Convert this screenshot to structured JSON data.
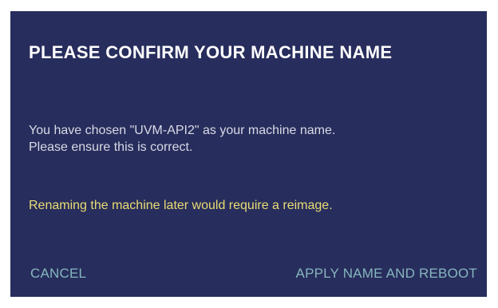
{
  "dialog": {
    "title": "PLEASE CONFIRM YOUR MACHINE NAME",
    "message_line1": "You have chosen \"UVM-API2\" as your machine name.",
    "message_line2": "Please ensure this is correct.",
    "warning": "Renaming the machine later would require a reimage.",
    "cancel_label": "CANCEL",
    "apply_label": "APPLY NAME AND REBOOT"
  },
  "colors": {
    "background": "#272d5c",
    "title": "#ffffff",
    "message": "#d8dae6",
    "warning": "#e9dc73",
    "action": "#86b6be"
  }
}
